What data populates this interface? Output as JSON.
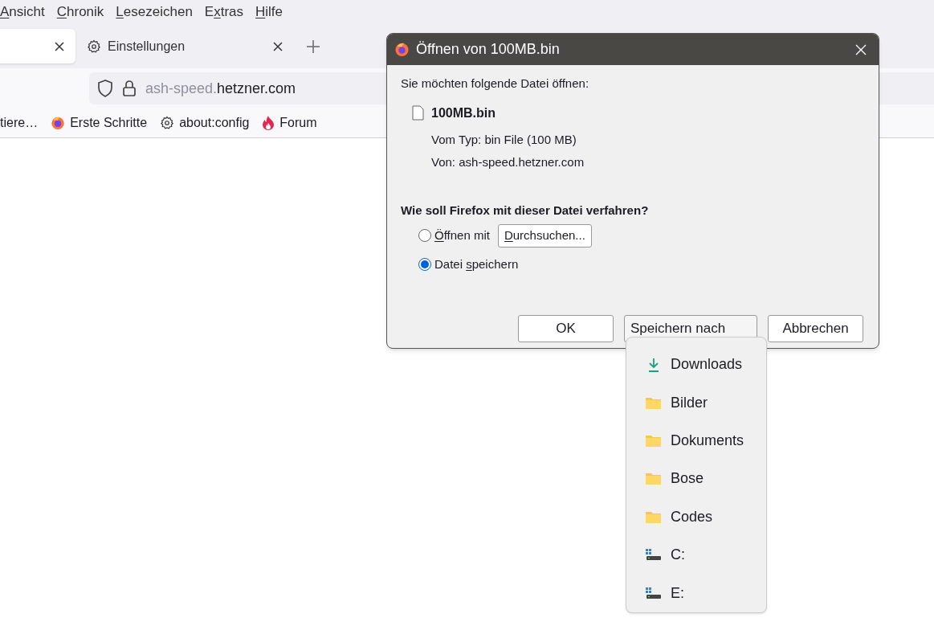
{
  "menu_bar": [
    {
      "key": "A",
      "rest": "nsicht"
    },
    {
      "key": "C",
      "rest": "hronik"
    },
    {
      "key": "L",
      "rest": "esezeichen"
    },
    {
      "before": "E",
      "key": "x",
      "rest": "tras"
    },
    {
      "key": "H",
      "rest": "ilfe"
    }
  ],
  "tabs": [
    {
      "selected": true
    },
    {
      "label": "Einstellungen",
      "selected": false
    }
  ],
  "url": {
    "prefix": "ash-speed.",
    "domain": "hetzner.com"
  },
  "bookmarks": [
    {
      "kind": "plain",
      "label": "tiere…"
    },
    {
      "kind": "firefox",
      "label": "Erste Schritte"
    },
    {
      "kind": "gear",
      "label": "about:config"
    },
    {
      "kind": "flame",
      "label": "Forum"
    }
  ],
  "dialog": {
    "title": "Öffnen von 100MB.bin",
    "intro": "Sie möchten folgende Datei öffnen:",
    "file_name": "100MB.bin",
    "file_type": "Vom Typ: bin File (100 MB)",
    "source": "Von: ash-speed.hetzner.com",
    "question": "Wie soll Firefox mit dieser Datei verfahren?",
    "options": [
      {
        "key": "Ö",
        "rest": "ffnen mit",
        "selected": false,
        "button": {
          "key": "D",
          "rest": "urchsuchen..."
        }
      },
      {
        "before": "Datei ",
        "key": "s",
        "rest": "peichern",
        "selected": true
      }
    ],
    "buttons": [
      {
        "label": "OK",
        "kind": "plain"
      },
      {
        "label": "Speichern nach",
        "kind": "menu"
      },
      {
        "label": "Abbrechen",
        "kind": "plain"
      }
    ]
  },
  "save_menu": [
    {
      "kind": "download",
      "label": "Downloads"
    },
    {
      "kind": "folder",
      "label": "Bilder"
    },
    {
      "kind": "folder",
      "label": "Dokuments"
    },
    {
      "kind": "folder",
      "label": "Bose"
    },
    {
      "kind": "folder",
      "label": "Codes"
    },
    {
      "kind": "drive",
      "label": "C:"
    },
    {
      "kind": "drive",
      "label": "E:"
    }
  ]
}
